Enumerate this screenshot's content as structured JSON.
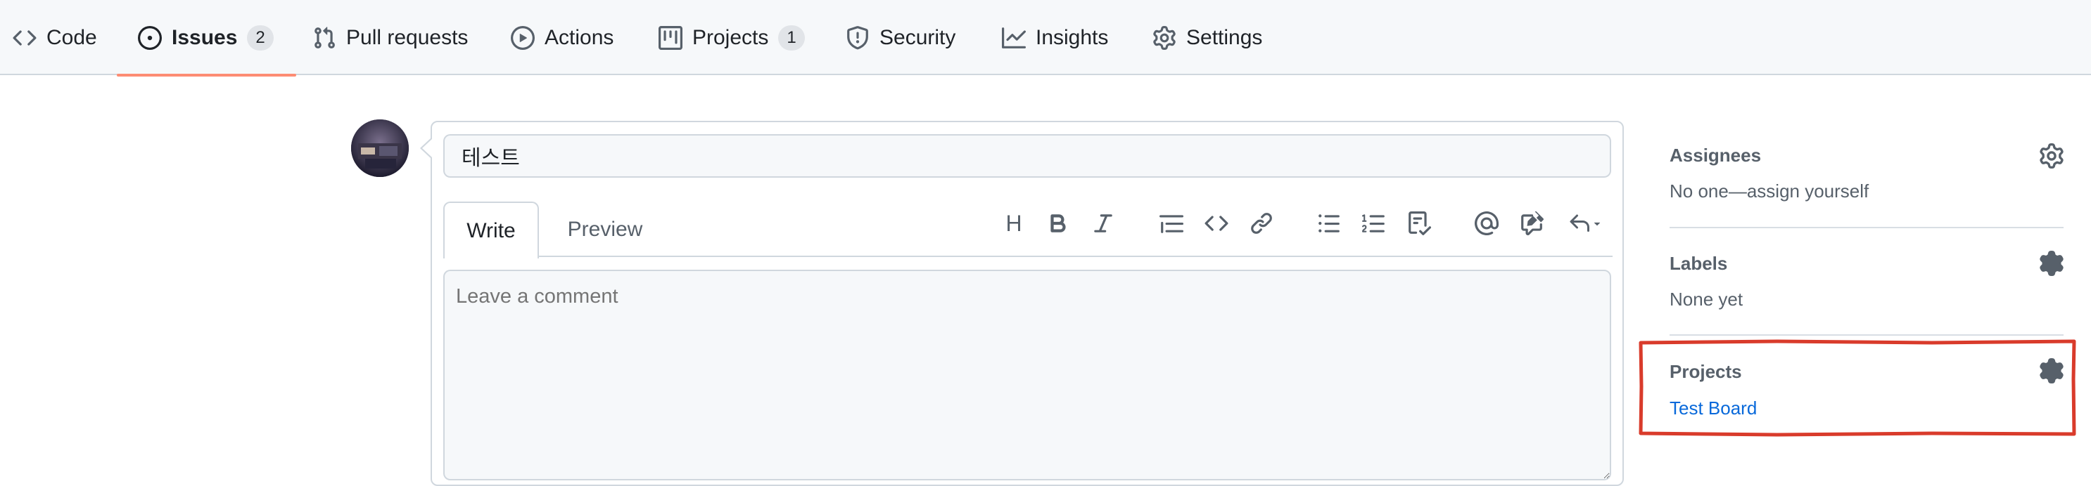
{
  "nav": {
    "tabs": [
      {
        "label": "Code",
        "icon": "code-icon"
      },
      {
        "label": "Issues",
        "icon": "issue-opened-icon",
        "count": "2",
        "active": true
      },
      {
        "label": "Pull requests",
        "icon": "git-pull-request-icon"
      },
      {
        "label": "Actions",
        "icon": "play-icon"
      },
      {
        "label": "Projects",
        "icon": "table-icon",
        "count": "1"
      },
      {
        "label": "Security",
        "icon": "shield-icon"
      },
      {
        "label": "Insights",
        "icon": "graph-icon"
      },
      {
        "label": "Settings",
        "icon": "gear-icon"
      }
    ],
    "active_indicator_color": "#fd8c73"
  },
  "issue_form": {
    "title_value": "테스트",
    "tabs": {
      "write": "Write",
      "preview": "Preview"
    },
    "toolbar": {
      "heading": "H",
      "icons": [
        "bold-icon",
        "italic-icon",
        "quote-icon",
        "code-icon",
        "link-icon",
        "unordered-list-icon",
        "ordered-list-icon",
        "task-list-icon",
        "mention-icon",
        "cross-reference-icon",
        "reply-icon"
      ]
    },
    "comment_placeholder": "Leave a comment"
  },
  "sidebar": {
    "assignees": {
      "heading": "Assignees",
      "value": "No one—assign yourself"
    },
    "labels": {
      "heading": "Labels",
      "value": "None yet"
    },
    "projects": {
      "heading": "Projects",
      "value": "Test Board"
    }
  },
  "colors": {
    "link": "#0969da",
    "highlight_box": "#d93b2b"
  }
}
